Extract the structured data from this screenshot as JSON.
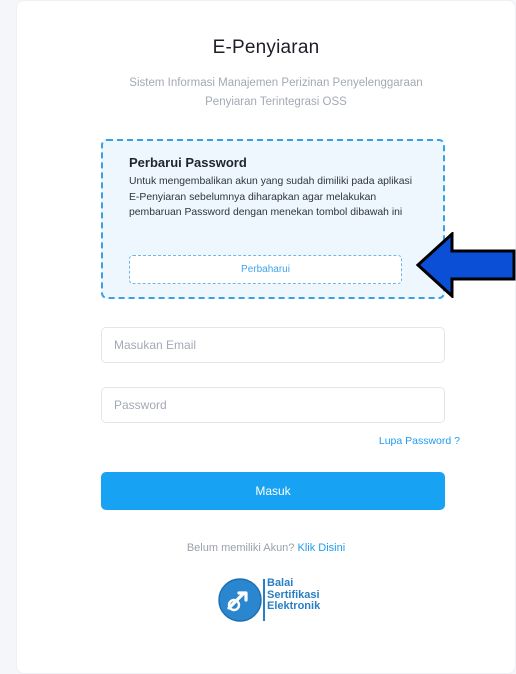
{
  "header": {
    "title": "E-Penyiaran",
    "subtitle_line1": "Sistem Informasi Manajemen Perizinan Penyelenggaraan",
    "subtitle_line2": "Penyiaran Terintegrasi OSS"
  },
  "notice": {
    "title": "Perbarui Password",
    "body": "Untuk mengembalikan akun yang sudah dimiliki pada aplikasi E-Penyiaran sebelumnya diharapkan agar melakukan pembaruan Password dengan menekan tombol dibawah ini",
    "button_label": "Perbaharui"
  },
  "form": {
    "email_placeholder": "Masukan Email",
    "email_value": "",
    "password_placeholder": "Password",
    "password_value": "",
    "forgot_label": "Lupa Password ?",
    "submit_label": "Masuk"
  },
  "register": {
    "prompt": "Belum memiliki Akun? ",
    "link_label": "Klik Disini"
  },
  "footer_logo": {
    "line1": "Balai",
    "line2": "Sertifikasi",
    "line3": "Elektronik",
    "icon": "bse-logo-icon"
  },
  "colors": {
    "accent": "#17a2f3",
    "arrow": "#0a4fd6",
    "notice_border": "#3aa0e6"
  }
}
